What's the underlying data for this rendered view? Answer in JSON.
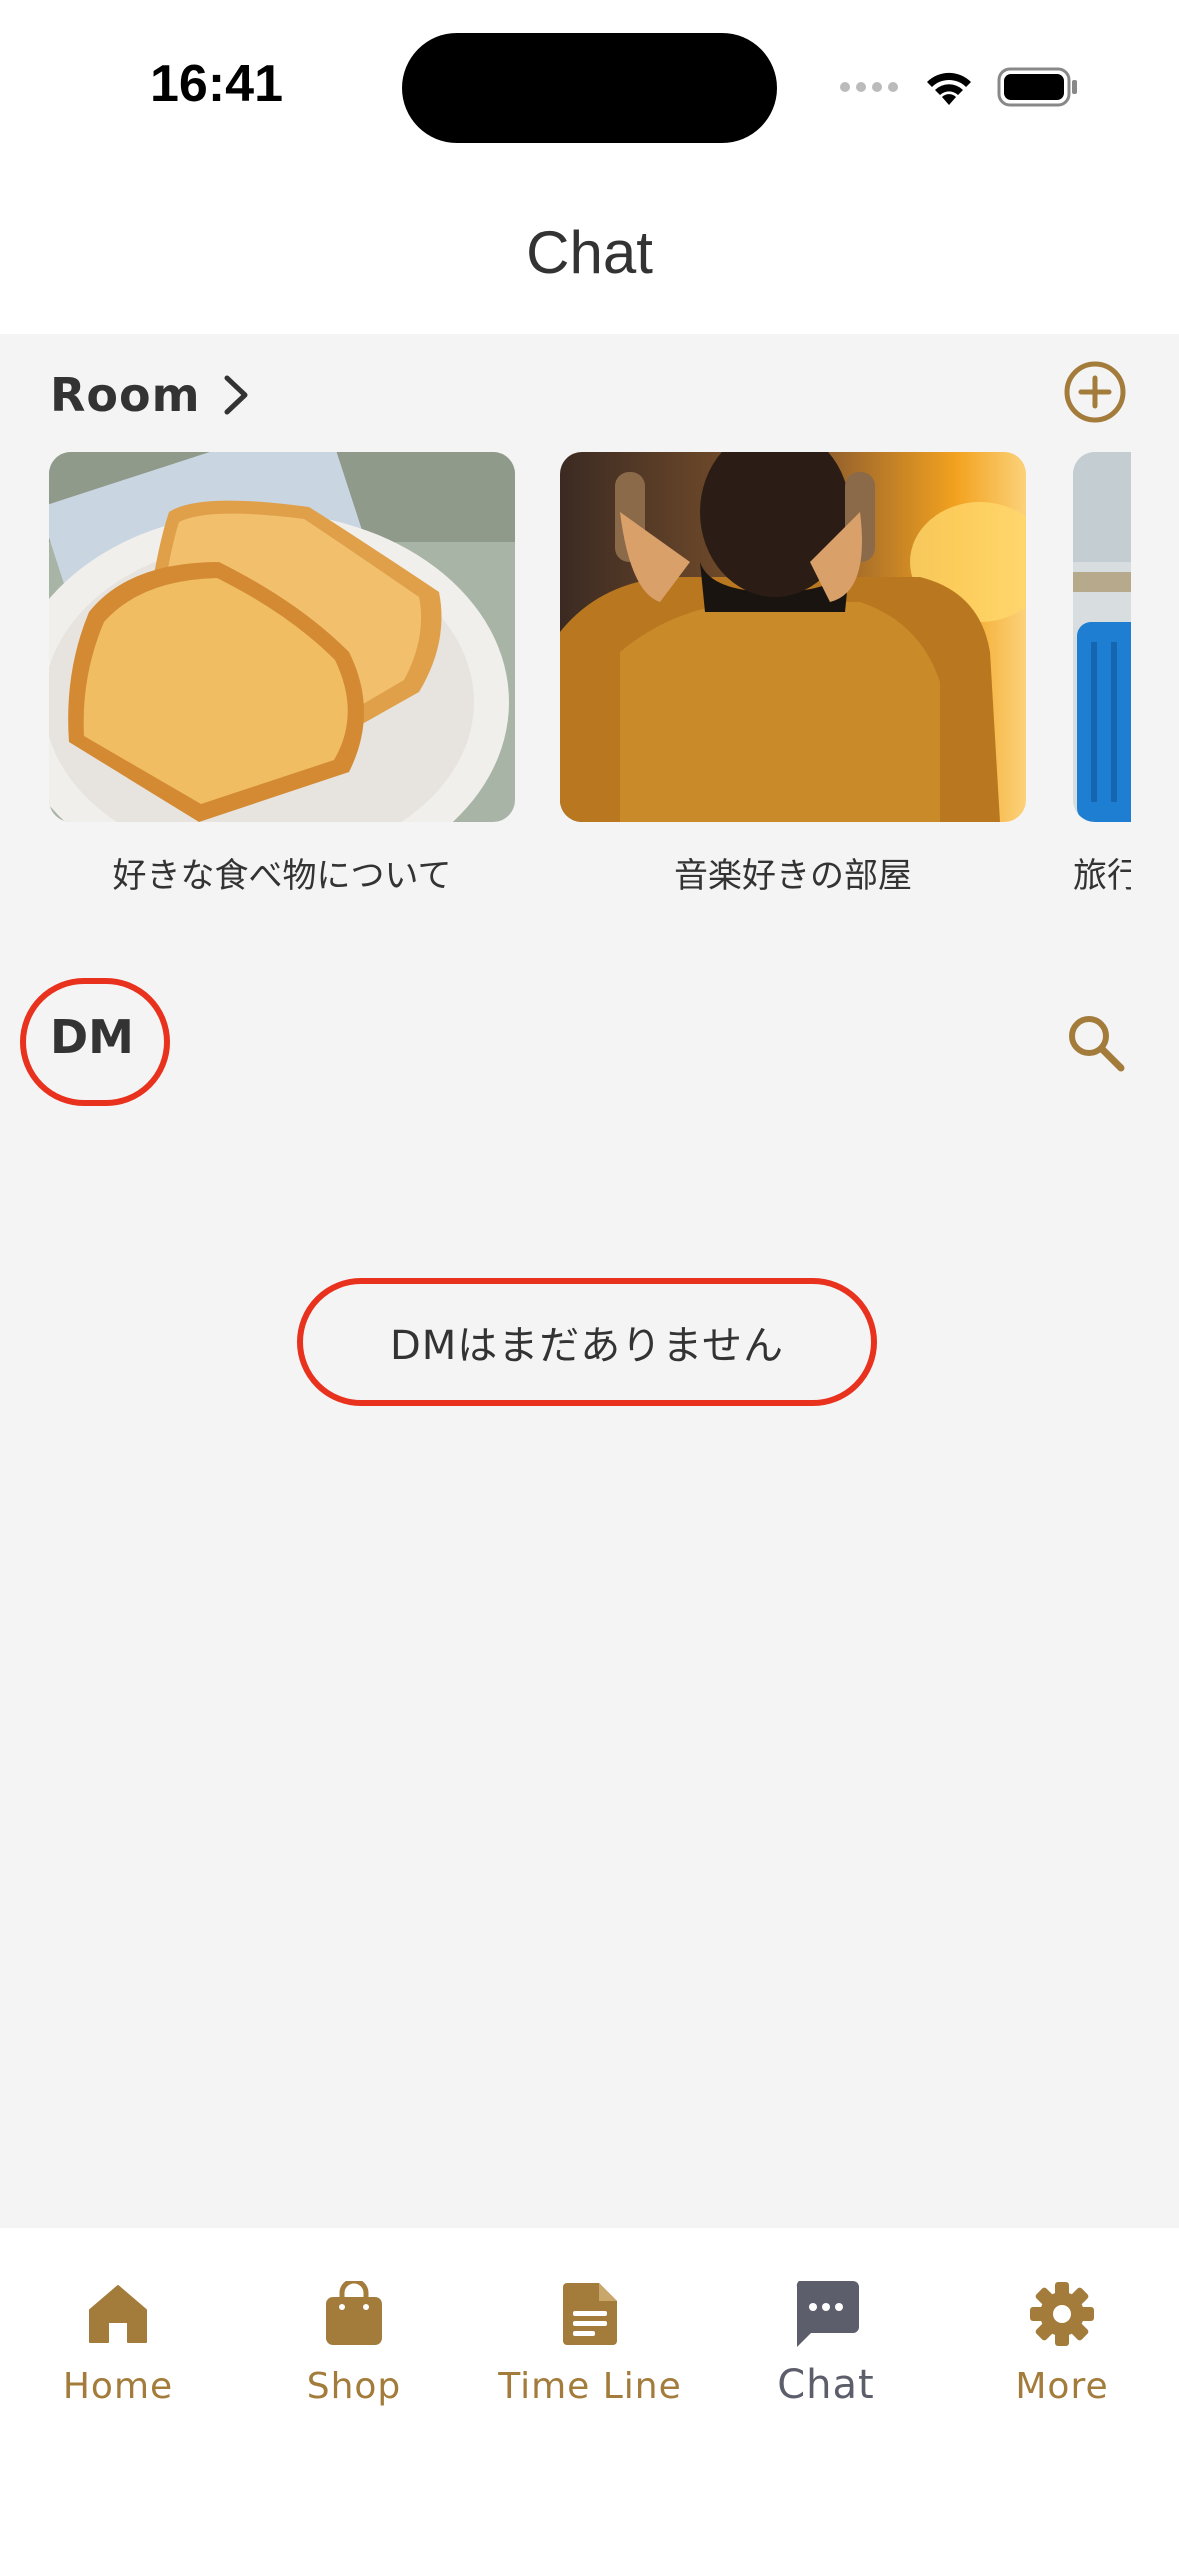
{
  "status_bar": {
    "time": "16:41"
  },
  "header": {
    "title": "Chat"
  },
  "rooms": {
    "title": "Room",
    "items": [
      {
        "name": "好きな食べ物について",
        "image": "toast-photo"
      },
      {
        "name": "音楽好きの部屋",
        "image": "headphones-photo"
      },
      {
        "name": "旅行",
        "image": "suitcase-photo"
      }
    ]
  },
  "dm": {
    "title": "DM",
    "empty_message": "DMはまだありません"
  },
  "tabs": [
    {
      "label": "Home",
      "icon": "home-icon"
    },
    {
      "label": "Shop",
      "icon": "shopping-bag-icon"
    },
    {
      "label": "Time Line",
      "icon": "document-icon"
    },
    {
      "label": "Chat",
      "icon": "chat-bubble-icon",
      "active": true
    },
    {
      "label": "More",
      "icon": "gear-icon"
    }
  ],
  "colors": {
    "accent": "#a37c3b",
    "active_tab": "#5c5e6b",
    "highlight": "#e8321e",
    "background": "#f4f4f4"
  }
}
